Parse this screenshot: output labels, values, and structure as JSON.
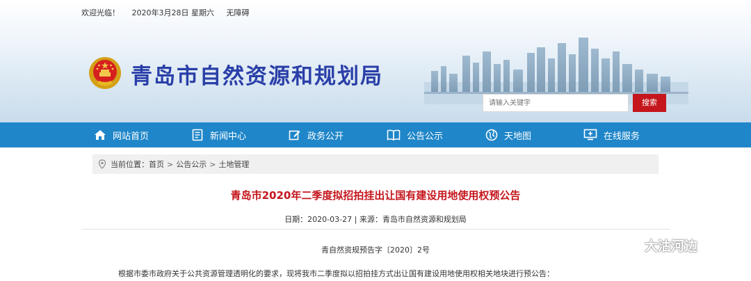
{
  "topbar": {
    "welcome": "欢迎光临！",
    "date": "2020年3月28日 星期六",
    "accessibility": "无障碍"
  },
  "site": {
    "title": "青岛市自然资源和规划局"
  },
  "search": {
    "placeholder": "请输入关键字",
    "button": "搜索"
  },
  "nav": {
    "items": [
      {
        "label": "网站首页",
        "icon": "home-icon"
      },
      {
        "label": "新闻中心",
        "icon": "news-icon"
      },
      {
        "label": "政务公开",
        "icon": "edit-icon"
      },
      {
        "label": "公告公示",
        "icon": "book-icon"
      },
      {
        "label": "天地图",
        "icon": "globe-icon"
      },
      {
        "label": "在线服务",
        "icon": "monitor-icon"
      }
    ]
  },
  "breadcrumb": {
    "prefix": "当前位置：",
    "items": [
      "首页",
      "公告公示",
      "土地管理"
    ],
    "separator": ">"
  },
  "article": {
    "title": "青岛市2020年二季度拟招拍挂出让国有建设用地使用权预公告",
    "meta": "日期：2020-03-27 | 来源：青岛市自然资源和规划局",
    "doc_number": "青自然资规预告字〔2020〕2号",
    "intro": "根据市委市政府关于公共资源管理透明化的要求，现将我市二季度拟以招拍挂方式出让国有建设用地使用权相关地块进行预公告："
  },
  "watermark": {
    "text": "大沽河边"
  },
  "colors": {
    "nav": "#1f86c9",
    "title_blue": "#2a3fa8",
    "accent_red": "#c4161c"
  }
}
